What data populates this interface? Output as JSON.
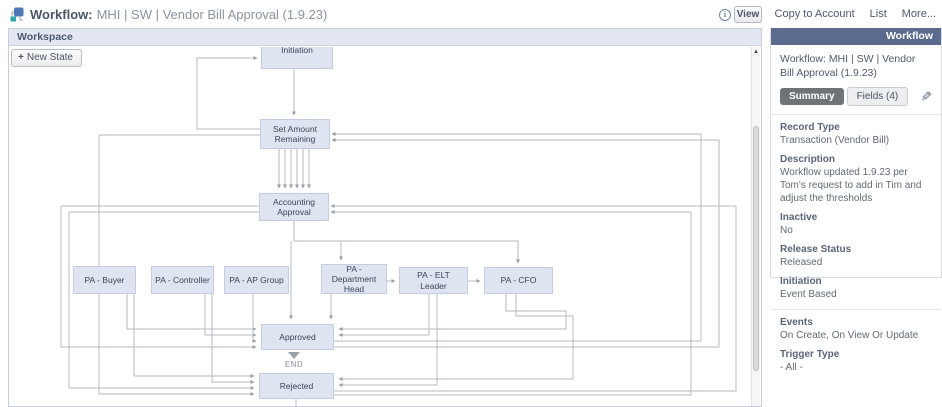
{
  "header": {
    "title_prefix": "Workflow:",
    "title_rest": "MHI | SW | Vendor Bill Approval (1.9.23)",
    "info_icon": "i",
    "view_button": "View"
  },
  "top_links": {
    "copy_to_account": "Copy to Account",
    "list": "List",
    "more": "More..."
  },
  "workspace": {
    "title": "Workspace",
    "new_state_plus": "+",
    "new_state_label": "New State",
    "end_label": "END",
    "nodes": [
      {
        "id": "initiation",
        "label": "Initiation"
      },
      {
        "id": "set-amount-remaining",
        "label": "Set Amount Remaining"
      },
      {
        "id": "accounting-approval",
        "label": "Accounting Approval"
      },
      {
        "id": "pa-buyer",
        "label": "PA - Buyer"
      },
      {
        "id": "pa-controller",
        "label": "PA - Controller"
      },
      {
        "id": "pa-ap-group",
        "label": "PA - AP Group"
      },
      {
        "id": "pa-department-head",
        "label": "PA - Department Head"
      },
      {
        "id": "pa-elt-leader",
        "label": "PA - ELT Leader"
      },
      {
        "id": "pa-cfo",
        "label": "PA - CFO"
      },
      {
        "id": "approved",
        "label": "Approved"
      },
      {
        "id": "rejected",
        "label": "Rejected"
      }
    ]
  },
  "sidebar": {
    "header": "Workflow",
    "title": "Workflow: MHI | SW | Vendor Bill Approval (1.9.23)",
    "tabs": {
      "summary": "Summary",
      "fields": "Fields (4)"
    },
    "fields": [
      {
        "label": "Record Type",
        "value": "Transaction (Vendor Bill)"
      },
      {
        "label": "Description",
        "value": "Workflow updated 1.9.23 per Tom's request to add in Tim and adjust the thresholds"
      },
      {
        "label": "Inactive",
        "value": "No"
      },
      {
        "label": "Release Status",
        "value": "Released"
      },
      {
        "label": "Initiation",
        "value": "Event Based"
      }
    ],
    "fields_secondary": [
      {
        "label": "Events",
        "value": "On Create, On View Or Update"
      },
      {
        "label": "Trigger Type",
        "value": "- All -"
      }
    ]
  },
  "colors": {
    "sidebar_header": "#5a6b8e",
    "workspace_bar": "#e3e7f2",
    "node_fill": "#dfe5f0",
    "node_border": "#c3cce0",
    "connector": "#b6bac2",
    "icon_blue": "#4e77b5",
    "icon_teal": "#2fa8a4"
  }
}
